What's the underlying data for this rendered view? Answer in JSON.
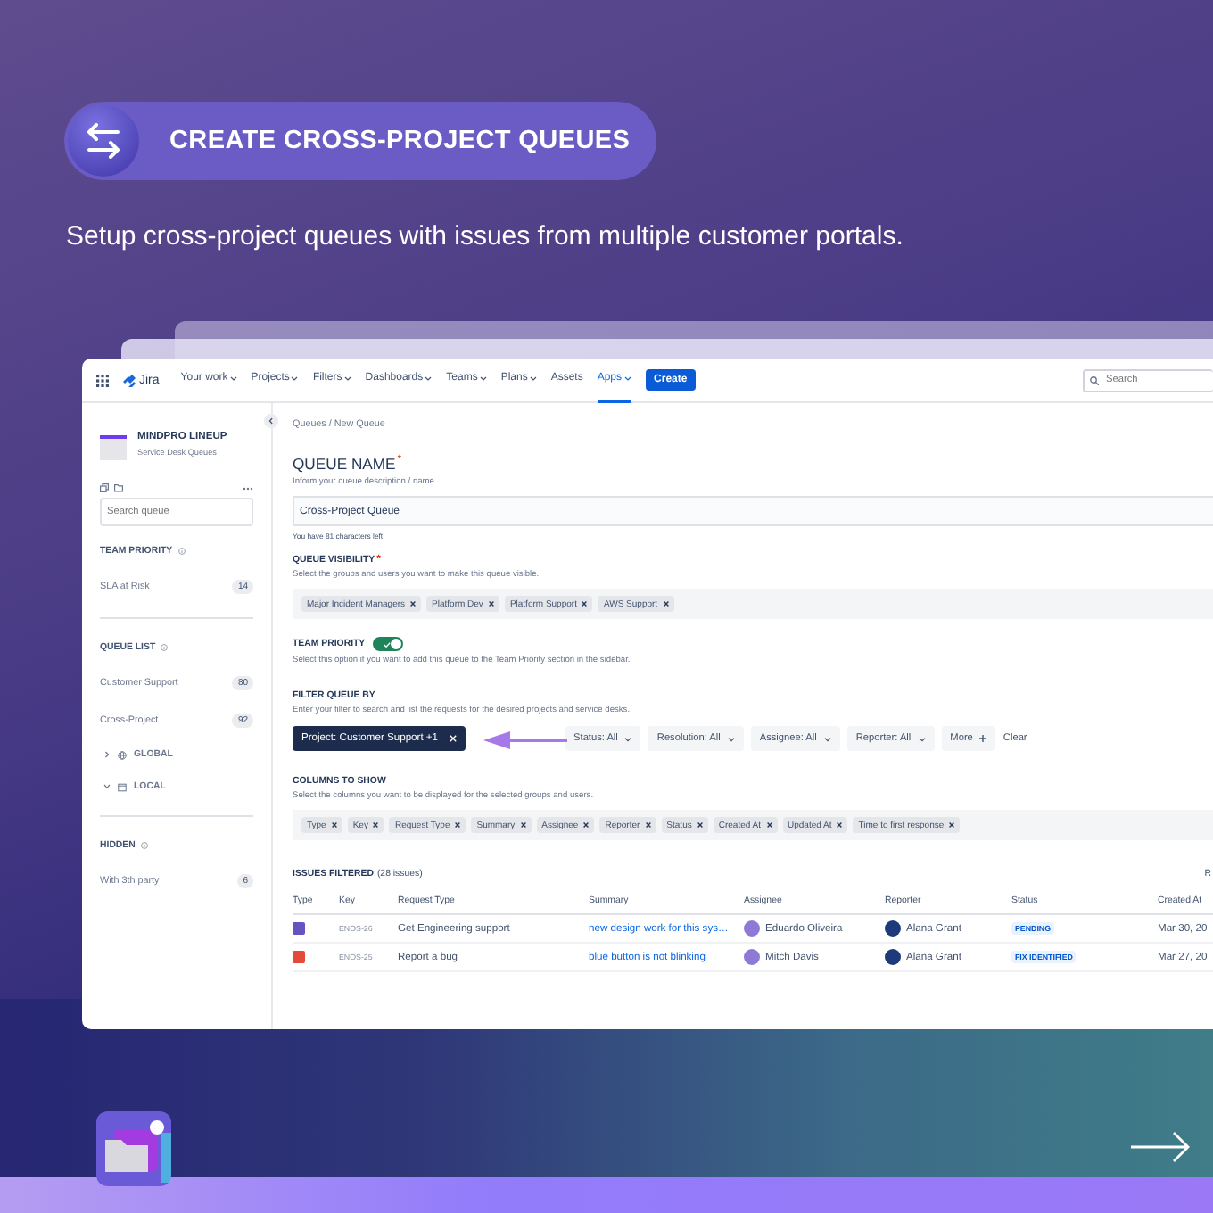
{
  "banner": {
    "title": "CREATE CROSS-PROJECT QUEUES",
    "subtitle": "Setup cross-project queues with issues from multiple customer portals."
  },
  "app": {
    "nav": {
      "logo": "Jira",
      "items": [
        {
          "label": "Your work",
          "dropdown": true,
          "selected": false
        },
        {
          "label": "Projects",
          "dropdown": true,
          "selected": false
        },
        {
          "label": "Filters",
          "dropdown": true,
          "selected": false
        },
        {
          "label": "Dashboards",
          "dropdown": true,
          "selected": false
        },
        {
          "label": "Teams",
          "dropdown": true,
          "selected": false
        },
        {
          "label": "Plans",
          "dropdown": true,
          "selected": false
        },
        {
          "label": "Assets",
          "dropdown": false,
          "selected": false
        },
        {
          "label": "Apps",
          "dropdown": true,
          "selected": true
        }
      ],
      "create": "Create",
      "search": {
        "placeholder": "Search"
      }
    },
    "sidebar": {
      "project": {
        "name": "MINDPRO LINEUP",
        "subtitle": "Service Desk Queues"
      },
      "search": {
        "placeholder": "Search queue"
      },
      "sections": [
        {
          "title": "TEAM PRIORITY",
          "items": [
            {
              "kind": "queue",
              "label": "SLA at Risk",
              "count": "14"
            }
          ]
        },
        {
          "title": "QUEUE LIST",
          "items": [
            {
              "kind": "queue",
              "label": "Customer Support",
              "count": "80"
            },
            {
              "kind": "queue",
              "label": "Cross-Project",
              "count": "92"
            },
            {
              "kind": "group",
              "label": "GLOBAL",
              "expanded": false
            },
            {
              "kind": "group",
              "label": "LOCAL",
              "expanded": true
            }
          ]
        },
        {
          "title": "HIDDEN",
          "items": [
            {
              "kind": "queue",
              "label": "With 3th party",
              "count": "6"
            }
          ]
        }
      ]
    },
    "main": {
      "breadcrumb": "Queues / New Queue",
      "queue_name": {
        "title": "QUEUE NAME",
        "required_mark": "*",
        "hint": "Inform your queue description / name.",
        "value": "Cross-Project Queue",
        "note": "You have 81 characters left."
      },
      "visibility": {
        "title": "QUEUE VISIBILITY",
        "required_mark": "*",
        "hint": "Select the groups and users you want to make this queue visible.",
        "tags": [
          "Major Incident Managers",
          "Platform Dev",
          "Platform Support",
          "AWS Support"
        ]
      },
      "team_priority": {
        "title": "TEAM PRIORITY",
        "on": true,
        "hint": "Select this option if you want to add this queue to the Team Priority section in the sidebar."
      },
      "filter": {
        "title": "FILTER QUEUE BY",
        "hint": "Enter your filter to search and list the requests for the desired projects and service desks.",
        "active": "Project: Customer Support +1",
        "filters": [
          "Status: All",
          "Resolution: All",
          "Assignee: All",
          "Reporter: All"
        ],
        "more": "More",
        "clear": "Clear"
      },
      "columns": {
        "title": "COLUMNS TO SHOW",
        "hint": "Select the columns you want to be displayed for the selected groups and users.",
        "tags": [
          "Type",
          "Key",
          "Request Type",
          "Summary",
          "Assignee",
          "Reporter",
          "Status",
          "Created At",
          "Updated At",
          "Time to first response"
        ]
      },
      "issues": {
        "title": "ISSUES FILTERED",
        "count": "(28 issues)",
        "column_right": "R",
        "columns": [
          "Type",
          "Key",
          "Request Type",
          "Summary",
          "Assignee",
          "Reporter",
          "Status",
          "Created At"
        ],
        "rows": [
          {
            "color": "#6554c0",
            "key": "ENOS-26",
            "request_type": "Get Engineering support",
            "summary": "new design work for this sys…",
            "assignee": "Eduardo Oliveira",
            "reporter": "Alana Grant",
            "status": "PENDING",
            "created": "Mar 30, 20"
          },
          {
            "color": "#e5493a",
            "key": "ENOS-25",
            "request_type": "Report a bug",
            "summary": "blue button is not blinking",
            "assignee": "Mitch Davis",
            "reporter": "Alana Grant",
            "status": "FIX IDENTIFIED",
            "created": "Mar 27, 20"
          }
        ]
      }
    }
  }
}
